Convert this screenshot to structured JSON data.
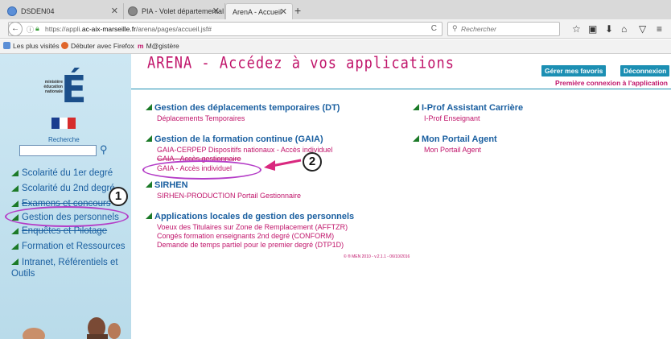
{
  "browser": {
    "tabs": [
      {
        "label": "DSDEN04",
        "active": false
      },
      {
        "label": "PIA - Volet départemental ...",
        "active": false
      },
      {
        "label": "ArenA - Accueil",
        "active": true
      }
    ],
    "new_tab": "+",
    "url_prefix": "https://appli.",
    "url_domain": "ac-aix-marseille.fr",
    "url_path": "/arena/pages/accueil.jsf#",
    "search_placeholder": "Rechercher",
    "bookmarks": [
      {
        "label": "Les plus visités",
        "color": "#5a8ed6"
      },
      {
        "label": "Débuter avec Firefox",
        "color": "#e0662b"
      },
      {
        "label": "M@gistère",
        "color": "#c0146a",
        "prefix": "m"
      }
    ]
  },
  "sidebar": {
    "logo_lines": [
      "ministère",
      "éducation",
      "nationale"
    ],
    "logo_letter": "É",
    "search_label": "Recherche",
    "items": [
      {
        "label": "Scolarité du 1er degré"
      },
      {
        "label": "Scolarité du 2nd degré"
      },
      {
        "label": "Examens et concours"
      },
      {
        "label": "Gestion des personnels"
      },
      {
        "label": "Enquêtes et Pilotage"
      },
      {
        "label": "Formation et Ressources"
      },
      {
        "label": "Intranet, Référentiels et Outils"
      }
    ]
  },
  "annotations": {
    "badge1": "1",
    "badge2": "2",
    "accent": "#b43cc7"
  },
  "main": {
    "title": "ARENA - Accédez à vos applications",
    "btn_favorites": "Gérer mes favoris",
    "btn_logout": "Déconnexion",
    "first_connection": "Première connexion à l'application",
    "sections_left": [
      {
        "title": "Gestion des déplacements temporaires (DT)",
        "items": [
          "Déplacements Temporaires"
        ]
      },
      {
        "title": "Gestion de la formation continue (GAIA)",
        "items": [
          "GAIA-CERPEP Dispositifs nationaux - Accès individuel",
          "GAIA - Accès gestionnaire",
          "GAIA - Accès individuel"
        ]
      },
      {
        "title": "SIRHEN",
        "items": [
          "SIRHEN-PRODUCTION Portail Gestionnaire"
        ]
      },
      {
        "title": "Applications locales de gestion des personnels",
        "items": [
          "Voeux des Titulaires sur Zone de Remplacement (AFFTZR)",
          "Congés formation enseignants 2nd degré (CONFORM)",
          "Demande de temps partiel pour le premier degré (DTP1D)"
        ]
      }
    ],
    "sections_right": [
      {
        "title": "I-Prof Assistant Carrière",
        "items": [
          "I-Prof Enseignant"
        ]
      },
      {
        "title": "Mon Portail Agent",
        "items": [
          "Mon Portail Agent"
        ]
      }
    ],
    "footer": "© ® MEN 2010 - v.2.1.1 - 06/10/2016"
  },
  "colors": {
    "title_pink": "#c0146a",
    "link_blue": "#1a5fa0",
    "button_teal": "#1c8fb3",
    "arrow_green": "#2e9f3a"
  }
}
